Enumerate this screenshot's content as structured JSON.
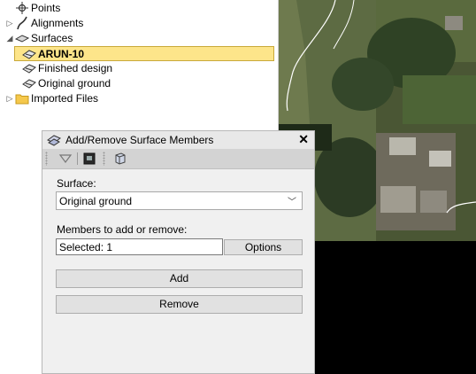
{
  "tree": {
    "items": [
      {
        "label": "Points",
        "icon": "points-icon"
      },
      {
        "label": "Alignments",
        "icon": "alignment-icon"
      },
      {
        "label": "Surfaces",
        "icon": "surfaces-icon"
      },
      {
        "label": "ARUN-10",
        "icon": "surface-icon",
        "selected": true
      },
      {
        "label": "Finished design",
        "icon": "surface-icon"
      },
      {
        "label": "Original ground",
        "icon": "surface-icon"
      },
      {
        "label": "Imported Files",
        "icon": "folder-icon"
      }
    ]
  },
  "dialog": {
    "title": "Add/Remove Surface Members",
    "close_label": "✕",
    "surface_label": "Surface:",
    "surface_value": "Original ground",
    "members_label": "Members to add or remove:",
    "members_value": "Selected: 1",
    "options_label": "Options",
    "add_label": "Add",
    "remove_label": "Remove"
  },
  "colors": {
    "selection_bg": "#fde58a",
    "dialog_bg": "#f0f0f0",
    "toolbar_bg": "#d3d3d3"
  }
}
